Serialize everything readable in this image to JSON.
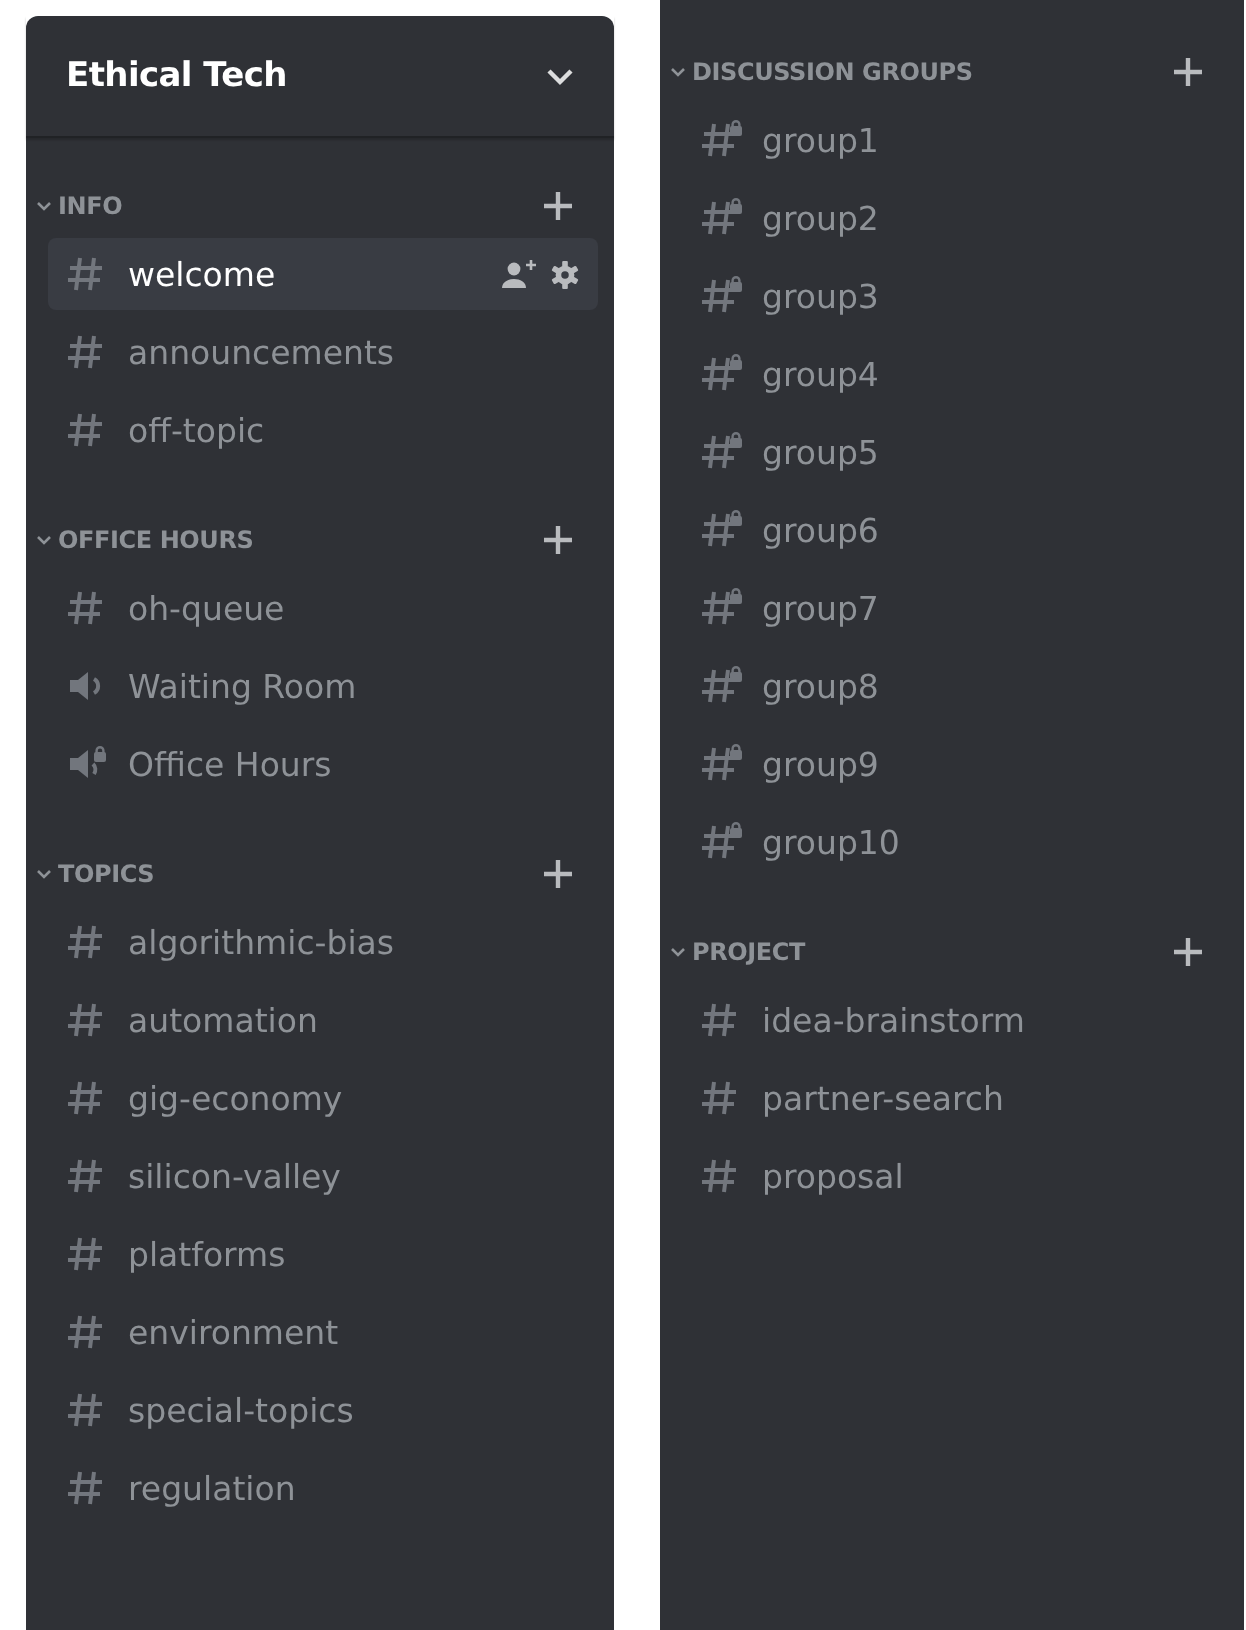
{
  "panels": [
    {
      "server_name": "Ethical Tech",
      "categories": [
        {
          "name": "INFO",
          "channels": [
            {
              "kind": "text",
              "name": "welcome",
              "selected": true
            },
            {
              "kind": "text",
              "name": "announcements",
              "selected": false
            },
            {
              "kind": "text",
              "name": "off-topic",
              "selected": false
            }
          ]
        },
        {
          "name": "OFFICE HOURS",
          "channels": [
            {
              "kind": "text",
              "name": "oh-queue",
              "selected": false
            },
            {
              "kind": "voice",
              "name": "Waiting Room",
              "selected": false
            },
            {
              "kind": "locked-voice",
              "name": "Office Hours",
              "selected": false
            }
          ]
        },
        {
          "name": "TOPICS",
          "channels": [
            {
              "kind": "text",
              "name": "algorithmic-bias",
              "selected": false
            },
            {
              "kind": "text",
              "name": "automation",
              "selected": false
            },
            {
              "kind": "text",
              "name": "gig-economy",
              "selected": false
            },
            {
              "kind": "text",
              "name": "silicon-valley",
              "selected": false
            },
            {
              "kind": "text",
              "name": "platforms",
              "selected": false
            },
            {
              "kind": "text",
              "name": "environment",
              "selected": false
            },
            {
              "kind": "text",
              "name": "special-topics",
              "selected": false
            },
            {
              "kind": "text",
              "name": "regulation",
              "selected": false
            }
          ]
        }
      ]
    },
    {
      "categories": [
        {
          "name": "DISCUSSION GROUPS",
          "channels": [
            {
              "kind": "locked-text",
              "name": "group1",
              "selected": false
            },
            {
              "kind": "locked-text",
              "name": "group2",
              "selected": false
            },
            {
              "kind": "locked-text",
              "name": "group3",
              "selected": false
            },
            {
              "kind": "locked-text",
              "name": "group4",
              "selected": false
            },
            {
              "kind": "locked-text",
              "name": "group5",
              "selected": false
            },
            {
              "kind": "locked-text",
              "name": "group6",
              "selected": false
            },
            {
              "kind": "locked-text",
              "name": "group7",
              "selected": false
            },
            {
              "kind": "locked-text",
              "name": "group8",
              "selected": false
            },
            {
              "kind": "locked-text",
              "name": "group9",
              "selected": false
            },
            {
              "kind": "locked-text",
              "name": "group10",
              "selected": false
            }
          ]
        },
        {
          "name": "PROJECT",
          "channels": [
            {
              "kind": "text",
              "name": "idea-brainstorm",
              "selected": false
            },
            {
              "kind": "text",
              "name": "partner-search",
              "selected": false
            },
            {
              "kind": "text",
              "name": "proposal",
              "selected": false
            }
          ]
        }
      ]
    }
  ]
}
